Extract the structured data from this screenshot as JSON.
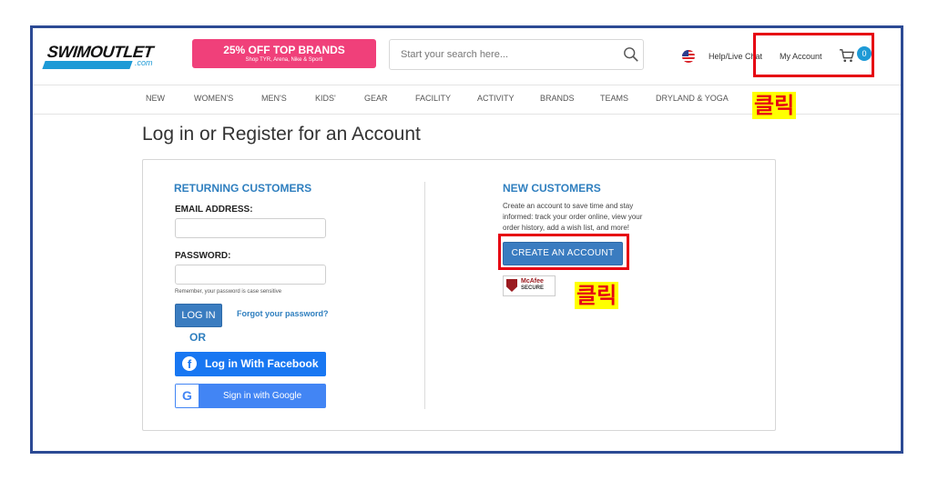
{
  "header": {
    "logo_main": "SWIMOUTLET",
    "logo_dotcom": ".com",
    "promo_title": "25% OFF TOP BRANDS",
    "promo_subtitle": "Shop TYR, Arena, Nike & Sporti",
    "search_placeholder": "Start your search here...",
    "help_label": "Help/Live Chat",
    "account_label": "My Account",
    "cart_count": "0"
  },
  "nav": {
    "items": [
      "NEW",
      "WOMEN'S",
      "MEN'S",
      "KIDS'",
      "GEAR",
      "FACILITY",
      "ACTIVITY",
      "BRANDS",
      "TEAMS",
      "DRYLAND & YOGA"
    ]
  },
  "page": {
    "title": "Log in or Register for an Account"
  },
  "returning": {
    "heading": "RETURNING CUSTOMERS",
    "email_label": "EMAIL ADDRESS:",
    "password_label": "PASSWORD:",
    "password_hint": "Remember, your password is case sensitive",
    "login_button": "LOG IN",
    "forgot_link": "Forgot your password?",
    "or_label": "OR",
    "facebook_button": "Log in With Facebook",
    "google_button": "Sign in with Google"
  },
  "new_customers": {
    "heading": "NEW CUSTOMERS",
    "description": "Create an account to save time and stay informed: track your order online, view your order history, add a wish list, and more!",
    "create_button": "CREATE AN ACCOUNT",
    "badge_top": "McAfee",
    "badge_bottom": "SECURE"
  },
  "annotations": {
    "label_1": "클릭",
    "label_2": "클릭",
    "box_color": "#e60012",
    "label_bg": "#ffff00"
  },
  "colors": {
    "accent_blue": "#2f7fbf",
    "promo_pink": "#f0407a",
    "facebook": "#1877f2",
    "google": "#4285f4",
    "frame": "#2c4a94"
  }
}
